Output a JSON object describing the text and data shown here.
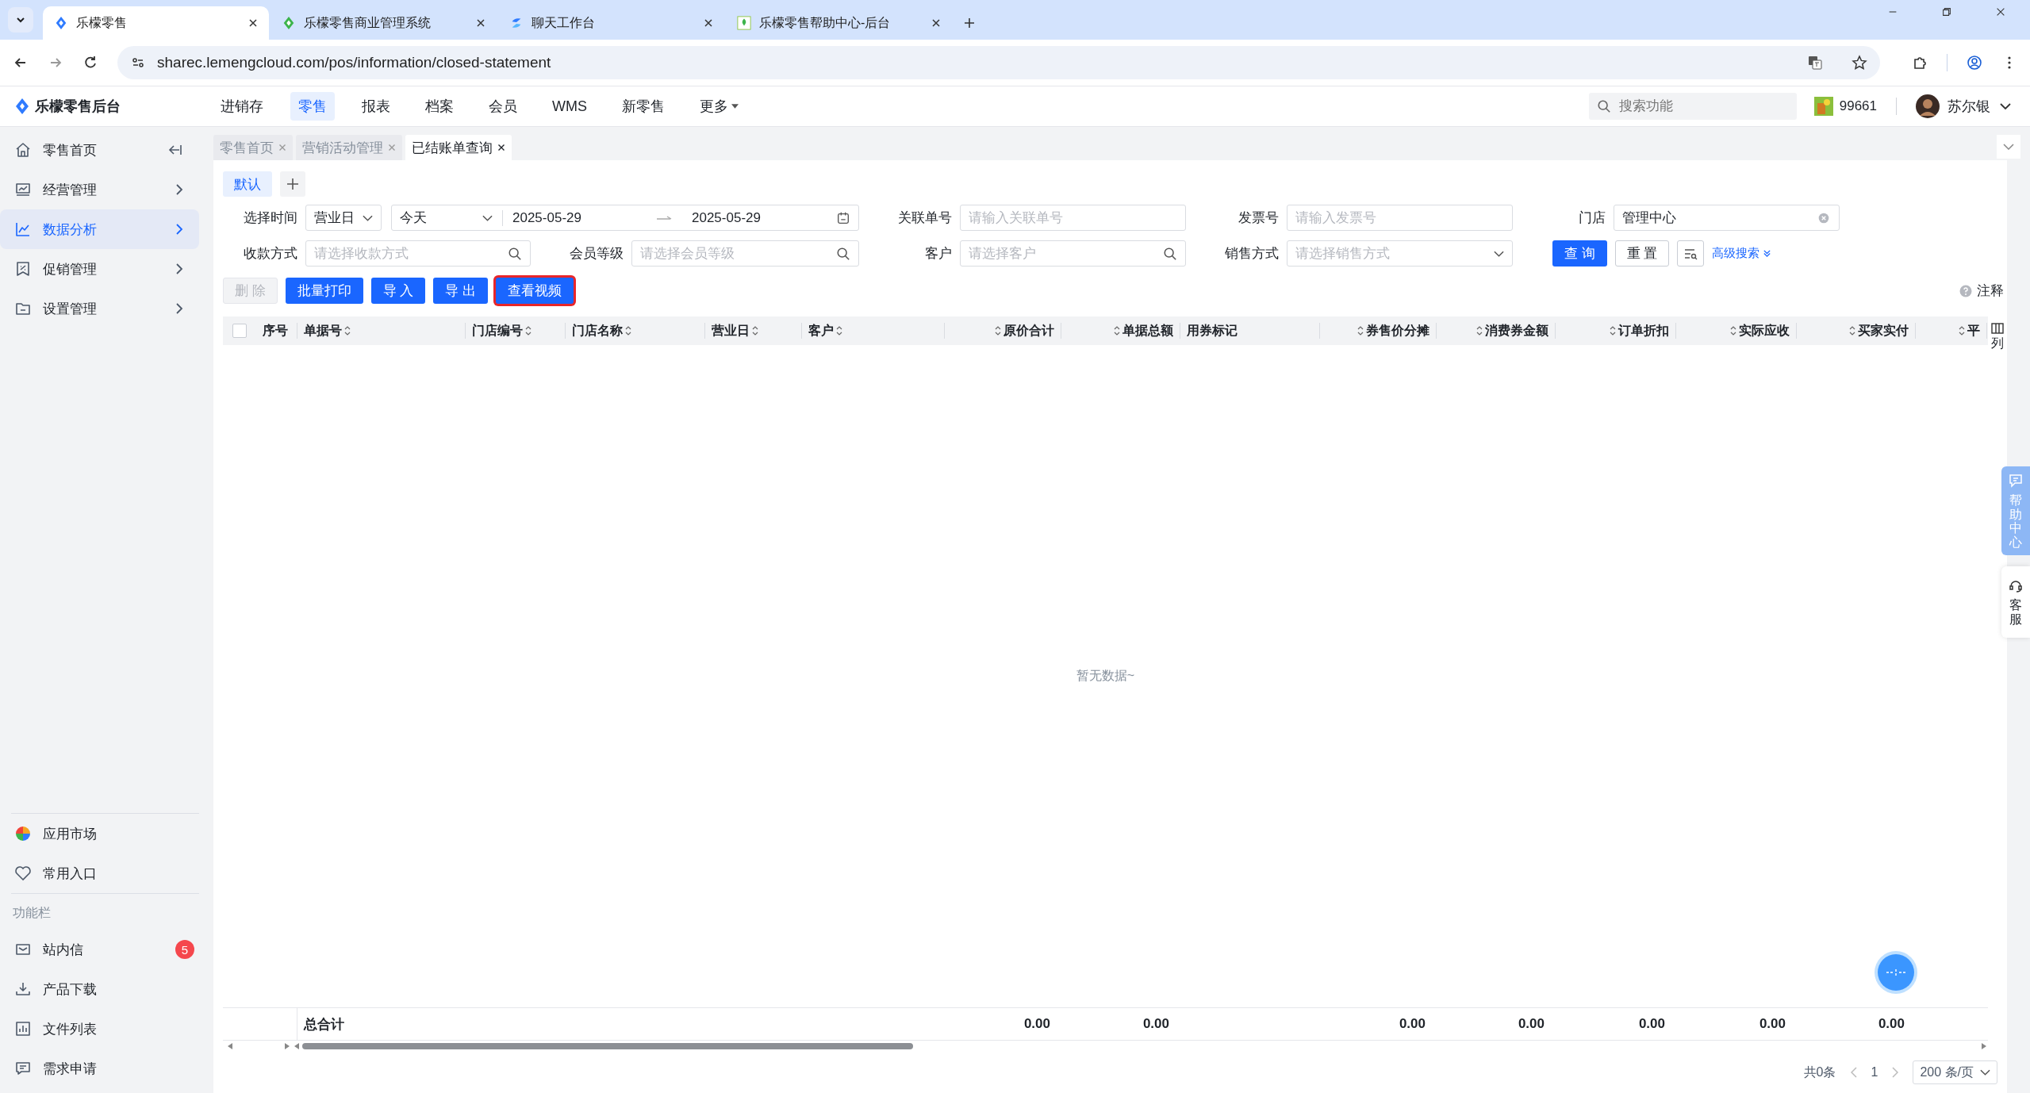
{
  "browser": {
    "tabs": [
      {
        "title": "乐檬零售",
        "selected": true
      },
      {
        "title": "乐檬零售商业管理系统",
        "selected": false
      },
      {
        "title": "聊天工作台",
        "selected": false
      },
      {
        "title": "乐檬零售帮助中心-后台",
        "selected": false
      }
    ],
    "url": "sharec.lemengcloud.com/pos/information/closed-statement"
  },
  "header": {
    "brand": "乐檬零售后台",
    "nav": [
      {
        "label": "进销存",
        "selected": false,
        "dropdown": false
      },
      {
        "label": "零售",
        "selected": true,
        "dropdown": false
      },
      {
        "label": "报表",
        "selected": false,
        "dropdown": false
      },
      {
        "label": "档案",
        "selected": false,
        "dropdown": false
      },
      {
        "label": "会员",
        "selected": false,
        "dropdown": false
      },
      {
        "label": "WMS",
        "selected": false,
        "dropdown": false
      },
      {
        "label": "新零售",
        "selected": false,
        "dropdown": false
      },
      {
        "label": "更多",
        "selected": false,
        "dropdown": true
      }
    ],
    "search": {
      "placeholder": "搜索功能"
    },
    "points": "99661",
    "user": "苏尔银"
  },
  "sidebar": {
    "menu": [
      {
        "label": "零售首页",
        "selected": false,
        "kind": "home"
      },
      {
        "label": "经营管理",
        "selected": false,
        "kind": "group"
      },
      {
        "label": "数据分析",
        "selected": true,
        "kind": "group"
      },
      {
        "label": "促销管理",
        "selected": false,
        "kind": "group"
      },
      {
        "label": "设置管理",
        "selected": false,
        "kind": "group"
      }
    ],
    "extras": [
      {
        "label": "应用市场"
      },
      {
        "label": "常用入口"
      }
    ],
    "section_title": "功能栏",
    "tools": [
      {
        "label": "站内信",
        "badge": "5"
      },
      {
        "label": "产品下载"
      },
      {
        "label": "文件列表"
      },
      {
        "label": "需求申请"
      }
    ]
  },
  "page_tabs": [
    {
      "label": "零售首页",
      "selected": false
    },
    {
      "label": "营销活动管理",
      "selected": false
    },
    {
      "label": "已结账单查询",
      "selected": true
    }
  ],
  "filter_schemes": [
    {
      "label": "默认",
      "selected": true
    }
  ],
  "filters": {
    "time": {
      "label": "选择时间",
      "basis": "营业日",
      "range": "今天",
      "start": "2025-05-29",
      "end": "2025-05-29"
    },
    "fields": [
      {
        "label": "关联单号",
        "placeholder": "请输入关联单号",
        "kind": "input"
      },
      {
        "label": "发票号",
        "placeholder": "请输入发票号",
        "kind": "input"
      },
      {
        "label": "门店",
        "value": "管理中心",
        "kind": "clearable"
      },
      {
        "label": "收款方式",
        "placeholder": "请选择收款方式",
        "kind": "search"
      },
      {
        "label": "会员等级",
        "placeholder": "请选择会员等级",
        "kind": "search"
      },
      {
        "label": "客户",
        "placeholder": "请选择客户",
        "kind": "search"
      },
      {
        "label": "销售方式",
        "placeholder": "请选择销售方式",
        "kind": "select"
      }
    ],
    "query": "查 询",
    "reset": "重 置",
    "advanced": "高级搜索"
  },
  "actions": [
    {
      "label": "删 除",
      "kind": "default",
      "disabled": true,
      "highlighted": false
    },
    {
      "label": "批量打印",
      "kind": "primary",
      "disabled": false,
      "highlighted": false
    },
    {
      "label": "导 入",
      "kind": "primary",
      "disabled": false,
      "highlighted": false
    },
    {
      "label": "导 出",
      "kind": "primary",
      "disabled": false,
      "highlighted": false
    },
    {
      "label": "查看视频",
      "kind": "primary",
      "disabled": false,
      "highlighted": true
    }
  ],
  "notes": "注释",
  "table": {
    "select_all": {
      "checked": false
    },
    "columns": [
      {
        "label": "序号",
        "kind": "text",
        "sortable": false
      },
      {
        "label": "单据号",
        "kind": "text",
        "sortable": true,
        "total": "总合计"
      },
      {
        "label": "门店编号",
        "kind": "text",
        "sortable": true
      },
      {
        "label": "门店名称",
        "kind": "text",
        "sortable": true
      },
      {
        "label": "营业日",
        "kind": "text",
        "sortable": true
      },
      {
        "label": "客户",
        "kind": "text",
        "sortable": true
      },
      {
        "label": "原价合计",
        "kind": "number",
        "sortable": true,
        "total": "0.00"
      },
      {
        "label": "单据总额",
        "kind": "number",
        "sortable": true,
        "total": "0.00"
      },
      {
        "label": "用券标记",
        "kind": "text",
        "sortable": false
      },
      {
        "label": "券售价分摊",
        "kind": "number",
        "sortable": true,
        "total": "0.00"
      },
      {
        "label": "消费券金额",
        "kind": "number",
        "sortable": true,
        "total": "0.00"
      },
      {
        "label": "订单折扣",
        "kind": "number",
        "sortable": true,
        "total": "0.00"
      },
      {
        "label": "实际应收",
        "kind": "number",
        "sortable": true,
        "total": "0.00"
      },
      {
        "label": "买家实付",
        "kind": "number",
        "sortable": true,
        "total": "0.00"
      },
      {
        "label": "平",
        "kind": "number",
        "sortable": true
      }
    ],
    "column_settings": "列",
    "empty": "暂无数据~"
  },
  "pagination": {
    "total": "共0条",
    "page": "1",
    "page_size": "200 条/页"
  },
  "side_tabs": [
    {
      "label": "帮助中心",
      "kind": "help"
    },
    {
      "label": "客服",
      "kind": "service"
    }
  ]
}
